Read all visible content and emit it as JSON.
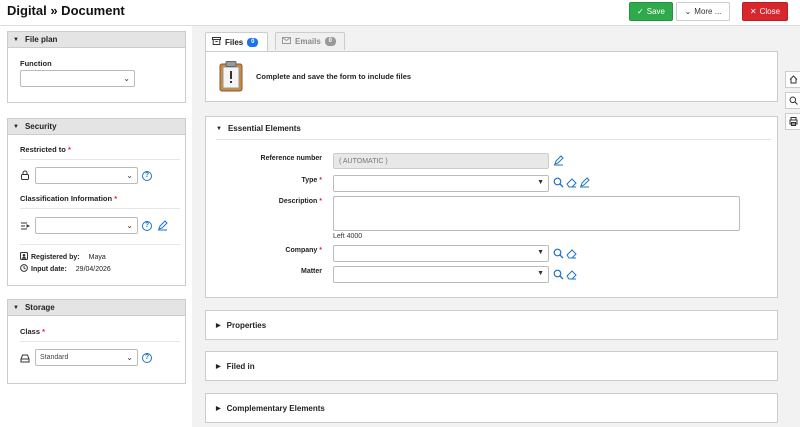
{
  "header": {
    "title": "Digital » Document",
    "save_label": "Save",
    "more_label": "More ...",
    "close_label": "Close"
  },
  "file_plan": {
    "title": "File plan",
    "function_label": "Function",
    "function_value": ""
  },
  "security": {
    "title": "Security",
    "restricted_label": "Restricted to",
    "restricted_value": "",
    "classification_label": "Classification Information",
    "classification_value": "",
    "registered_label": "Registered by:",
    "registered_value": "Maya",
    "input_date_label": "Input date:",
    "input_date_value": "29/04/2026",
    "required_marker": "*"
  },
  "storage": {
    "title": "Storage",
    "class_label": "Class",
    "class_value": "Standard"
  },
  "tabs": {
    "files_label": "Files",
    "files_count": "0",
    "emails_label": "Emails",
    "emails_count": "0"
  },
  "files": {
    "message": "Complete and save the form to include files"
  },
  "essential": {
    "title": "Essential Elements",
    "reference_label": "Reference number",
    "reference_value": "( AUTOMATIC )",
    "type_label": "Type",
    "description_label": "Description",
    "counter_text": "Left 4000",
    "company_label": "Company",
    "matter_label": "Matter",
    "required_marker": "*"
  },
  "sections": {
    "properties": "Properties",
    "filed_in": "Filed in",
    "complementary": "Complementary Elements"
  },
  "colors": {
    "save": "#2eaa4a",
    "close": "#d9262c",
    "link_icon": "#1a73c8"
  }
}
